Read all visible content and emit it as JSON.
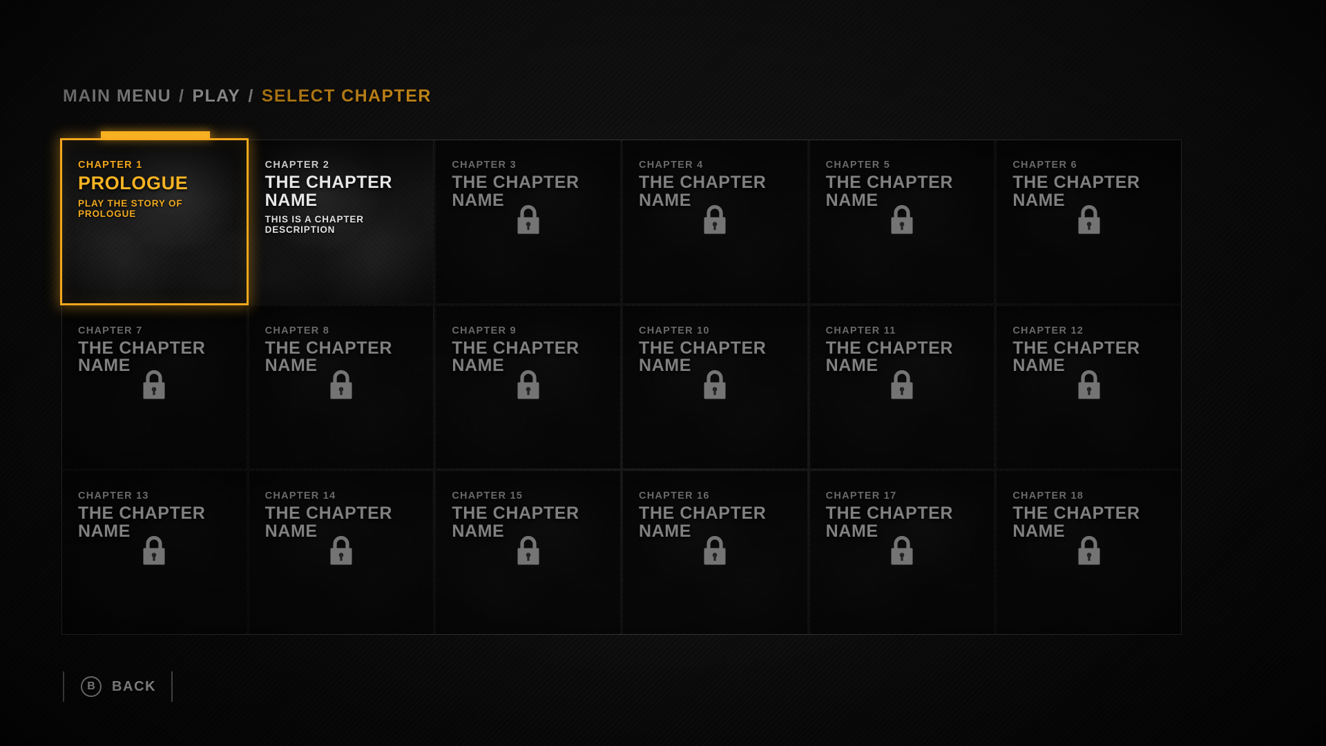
{
  "breadcrumb": {
    "items": [
      "MAIN MENU",
      "PLAY",
      "SELECT CHAPTER"
    ],
    "separator": "/",
    "active_index": 2,
    "accent_color": "#f5a81c"
  },
  "grid": {
    "columns": 6,
    "rows": 3,
    "total_chapters": 18
  },
  "chapters": [
    {
      "num": "CHAPTER 1",
      "name": "PROLOGUE",
      "desc": "PLAY THE STORY OF PROLOGUE",
      "state": "selected",
      "locked": false
    },
    {
      "num": "CHAPTER 2",
      "name": "THE CHAPTER NAME",
      "desc": "THIS IS A CHAPTER DESCRIPTION",
      "state": "unlocked",
      "locked": false
    },
    {
      "num": "CHAPTER 3",
      "name": "THE CHAPTER NAME",
      "desc": "",
      "state": "locked",
      "locked": true
    },
    {
      "num": "CHAPTER 4",
      "name": "THE CHAPTER NAME",
      "desc": "",
      "state": "locked",
      "locked": true
    },
    {
      "num": "CHAPTER 5",
      "name": "THE CHAPTER NAME",
      "desc": "",
      "state": "locked",
      "locked": true
    },
    {
      "num": "CHAPTER 6",
      "name": "THE CHAPTER NAME",
      "desc": "",
      "state": "locked",
      "locked": true
    },
    {
      "num": "CHAPTER 7",
      "name": "THE CHAPTER NAME",
      "desc": "",
      "state": "locked",
      "locked": true
    },
    {
      "num": "CHAPTER 8",
      "name": "THE CHAPTER NAME",
      "desc": "",
      "state": "locked",
      "locked": true
    },
    {
      "num": "CHAPTER 9",
      "name": "THE CHAPTER NAME",
      "desc": "",
      "state": "locked",
      "locked": true
    },
    {
      "num": "CHAPTER 10",
      "name": "THE CHAPTER NAME",
      "desc": "",
      "state": "locked",
      "locked": true
    },
    {
      "num": "CHAPTER 11",
      "name": "THE CHAPTER NAME",
      "desc": "",
      "state": "locked",
      "locked": true
    },
    {
      "num": "CHAPTER 12",
      "name": "THE CHAPTER NAME",
      "desc": "",
      "state": "locked",
      "locked": true
    },
    {
      "num": "CHAPTER 13",
      "name": "THE CHAPTER NAME",
      "desc": "",
      "state": "locked",
      "locked": true
    },
    {
      "num": "CHAPTER 14",
      "name": "THE CHAPTER NAME",
      "desc": "",
      "state": "locked",
      "locked": true
    },
    {
      "num": "CHAPTER 15",
      "name": "THE CHAPTER NAME",
      "desc": "",
      "state": "locked",
      "locked": true
    },
    {
      "num": "CHAPTER 16",
      "name": "THE CHAPTER NAME",
      "desc": "",
      "state": "locked",
      "locked": true
    },
    {
      "num": "CHAPTER 17",
      "name": "THE CHAPTER NAME",
      "desc": "",
      "state": "locked",
      "locked": true
    },
    {
      "num": "CHAPTER 18",
      "name": "THE CHAPTER NAME",
      "desc": "",
      "state": "locked",
      "locked": true
    }
  ],
  "footer": {
    "back_glyph": "B",
    "back_label": "BACK"
  },
  "icons": {
    "lock": "lock-icon"
  }
}
